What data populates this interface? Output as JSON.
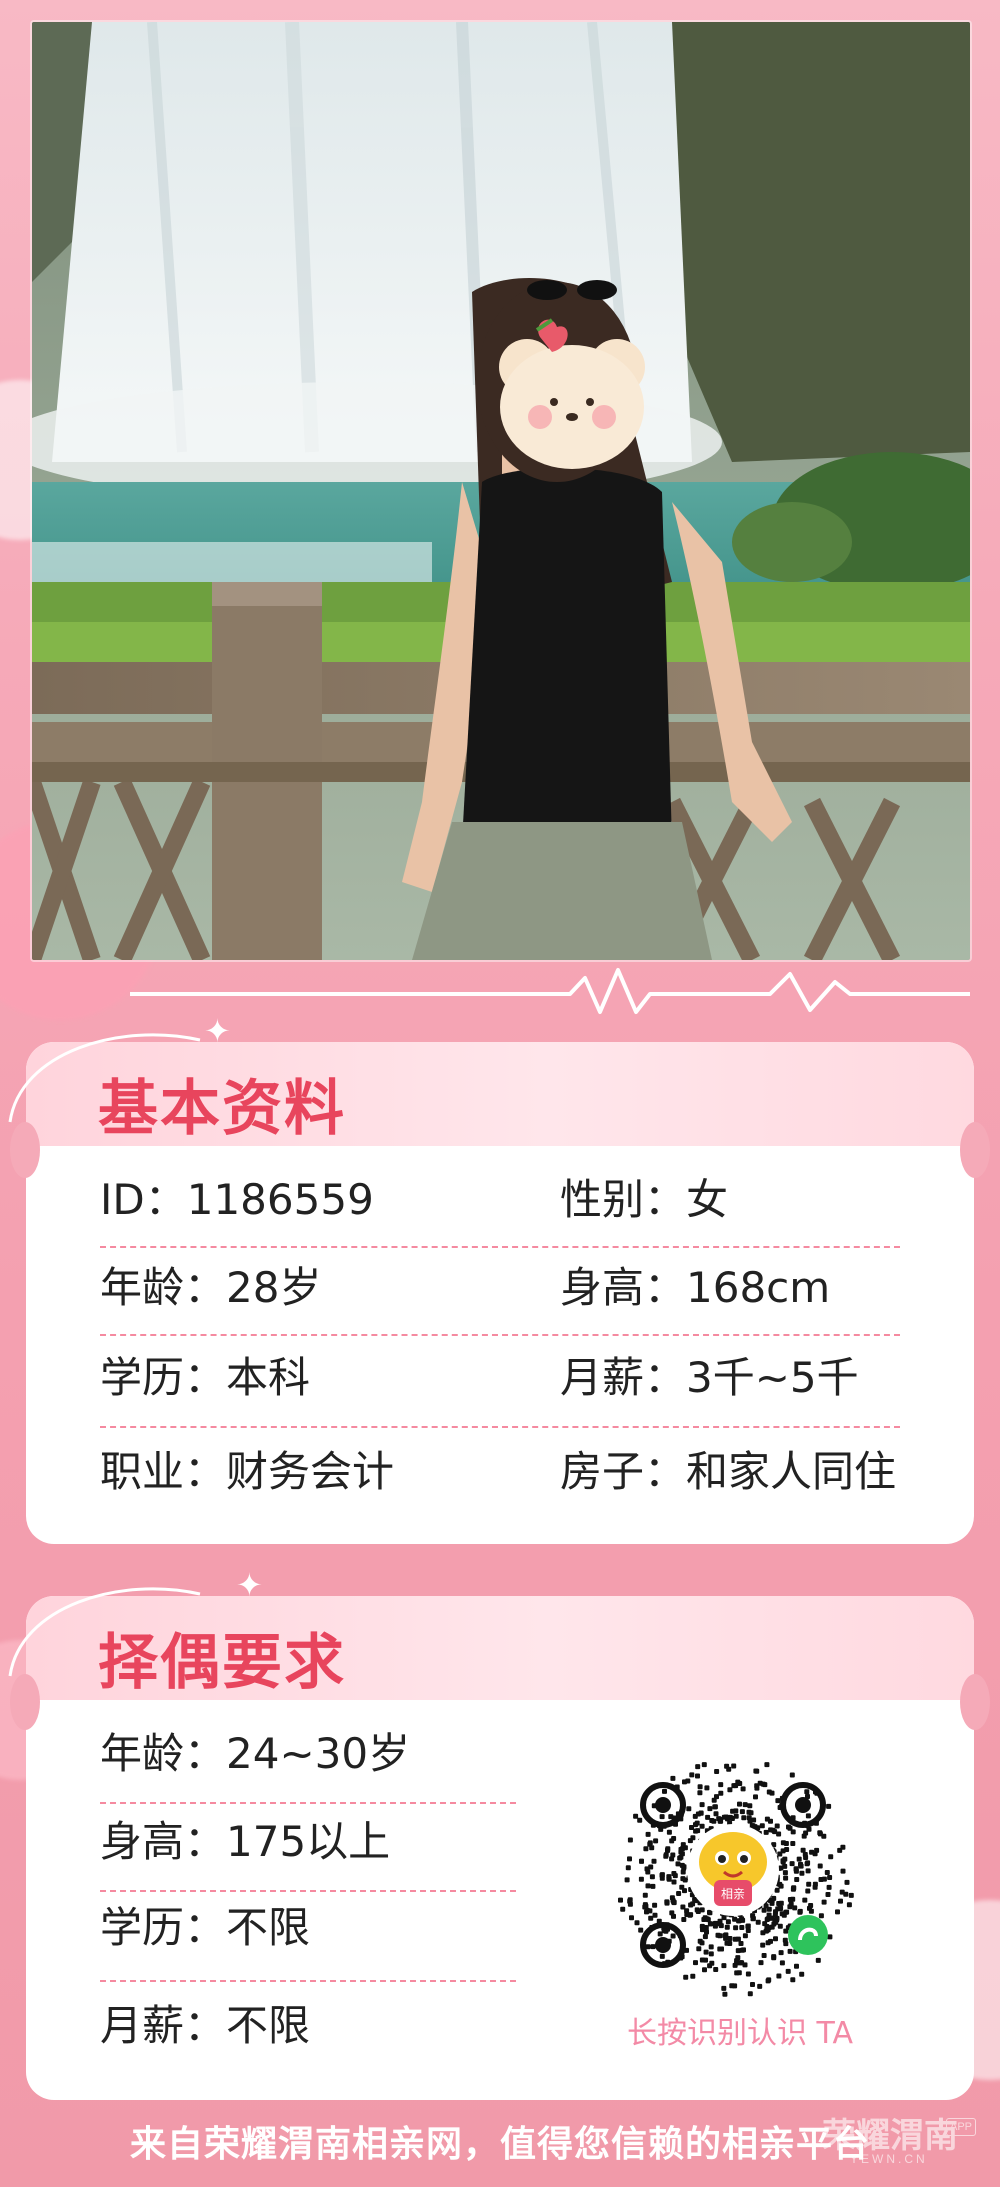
{
  "profile": {
    "section_title": "基本资料",
    "fields": [
      {
        "label": "ID：",
        "value": "1186559"
      },
      {
        "label": "性别：",
        "value": "女"
      },
      {
        "label": "年龄：",
        "value": "28岁"
      },
      {
        "label": "身高：",
        "value": "168cm"
      },
      {
        "label": "学历：",
        "value": "本科"
      },
      {
        "label": "月薪：",
        "value": "3千~5千"
      },
      {
        "label": "职业：",
        "value": "财务会计"
      },
      {
        "label": "房子：",
        "value": "和家人同住"
      }
    ]
  },
  "requirements": {
    "section_title": "择偶要求",
    "fields": [
      {
        "label": "年龄：",
        "value": "24~30岁"
      },
      {
        "label": "身高：",
        "value": "175以上"
      },
      {
        "label": "学历：",
        "value": "不限"
      },
      {
        "label": "月薪：",
        "value": "不限"
      }
    ],
    "qr_caption": "长按识别认识 TA",
    "qr_badge": "相亲"
  },
  "footer": {
    "text": "来自荣耀渭南相亲网，值得您信赖的相亲平台",
    "logo_text": "荣耀渭南",
    "logo_sub": "YEWN.CN",
    "logo_app": "APP"
  },
  "colors": {
    "accent": "#e8455d",
    "background": "#f6a9b8",
    "dash": "#f58aa0"
  }
}
